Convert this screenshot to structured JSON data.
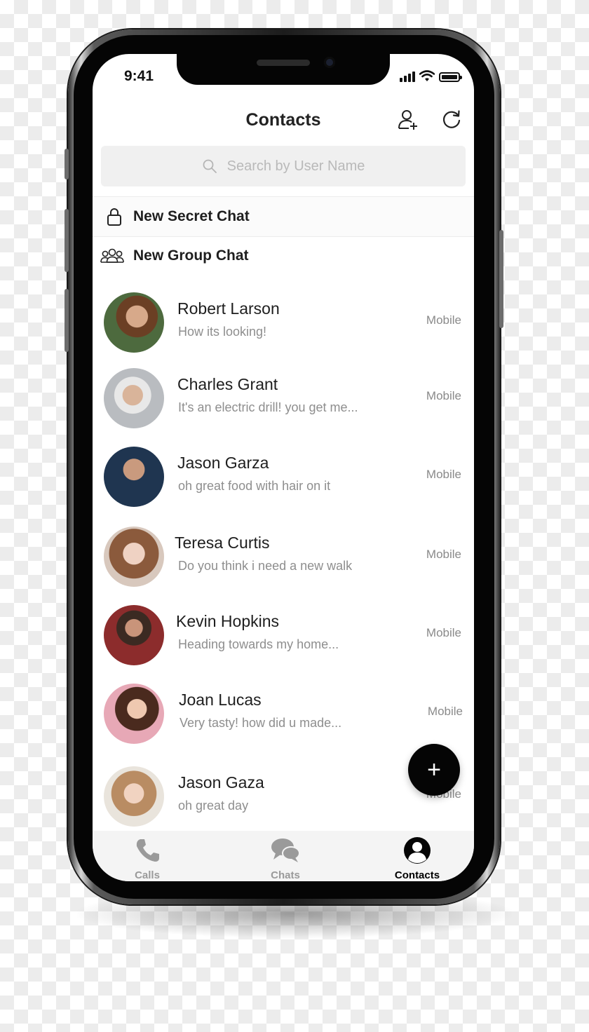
{
  "status_bar": {
    "time": "9:41"
  },
  "header": {
    "title": "Contacts",
    "add_contact_icon": "add-user-icon",
    "refresh_icon": "refresh-icon"
  },
  "search": {
    "placeholder": "Search by User Name",
    "icon": "search-icon"
  },
  "actions": [
    {
      "label": "New Secret Chat",
      "icon": "lock-icon"
    },
    {
      "label": "New Group Chat",
      "icon": "group-icon"
    }
  ],
  "contacts": [
    {
      "name": "Robert Larson",
      "message": "How its looking!",
      "type": "Mobile"
    },
    {
      "name": "Charles Grant",
      "message": "It's an electric drill! you get me...",
      "type": "Mobile"
    },
    {
      "name": "Jason Garza",
      "message": "oh great food with hair on it",
      "type": "Mobile"
    },
    {
      "name": "Teresa Curtis",
      "message": "Do you think i need a new walk",
      "type": "Mobile"
    },
    {
      "name": "Kevin Hopkins",
      "message": "Heading towards my home...",
      "type": "Mobile"
    },
    {
      "name": "Joan Lucas",
      "message": "Very tasty! how did u made...",
      "type": "Mobile"
    },
    {
      "name": "Jason Gaza",
      "message": "oh great day",
      "type": "Mobile"
    }
  ],
  "fab": {
    "label": "+"
  },
  "tabs": [
    {
      "label": "Calls",
      "icon": "phone-icon",
      "active": false
    },
    {
      "label": "Chats",
      "icon": "chat-bubbles-icon",
      "active": false
    },
    {
      "label": "Contacts",
      "icon": "contact-icon",
      "active": true
    }
  ],
  "colors": {
    "text_primary": "#1e1e1e",
    "text_secondary": "#8e8e8e",
    "tab_inactive": "#9a9a9a",
    "tab_active": "#000000",
    "fab": "#050505",
    "search_bg": "#f0f0f0"
  }
}
